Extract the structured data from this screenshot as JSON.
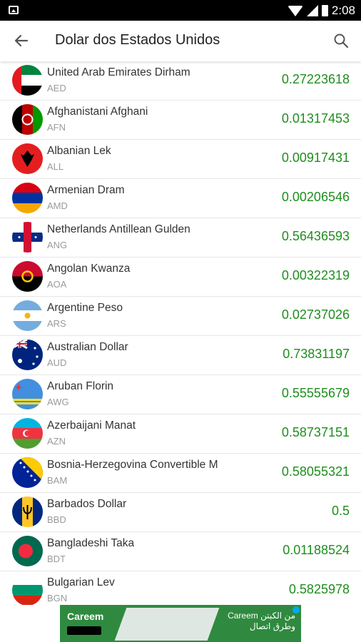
{
  "status": {
    "time": "2:08"
  },
  "appbar": {
    "title": "Dolar dos Estados Unidos"
  },
  "colors": {
    "rate": "#1e8e1e",
    "code": "#9a9a9a",
    "name": "#333333"
  },
  "currencies": [
    {
      "name": "United Arab Emirates Dirham",
      "code": "AED",
      "rate": "0.27223618"
    },
    {
      "name": "Afghanistani Afghani",
      "code": "AFN",
      "rate": "0.01317453"
    },
    {
      "name": "Albanian Lek",
      "code": "ALL",
      "rate": "0.00917431"
    },
    {
      "name": "Armenian Dram",
      "code": "AMD",
      "rate": "0.00206546"
    },
    {
      "name": "Netherlands Antillean Gulden",
      "code": "ANG",
      "rate": "0.56436593"
    },
    {
      "name": "Angolan Kwanza",
      "code": "AOA",
      "rate": "0.00322319"
    },
    {
      "name": "Argentine Peso",
      "code": "ARS",
      "rate": "0.02737026"
    },
    {
      "name": "Australian Dollar",
      "code": "AUD",
      "rate": "0.73831197"
    },
    {
      "name": "Aruban Florin",
      "code": "AWG",
      "rate": "0.55555679"
    },
    {
      "name": "Azerbaijani Manat",
      "code": "AZN",
      "rate": "0.58737151"
    },
    {
      "name": "Bosnia-Herzegovina Convertible M",
      "code": "BAM",
      "rate": "0.58055321"
    },
    {
      "name": "Barbados Dollar",
      "code": "BBD",
      "rate": "0.5"
    },
    {
      "name": "Bangladeshi Taka",
      "code": "BDT",
      "rate": "0.01188524"
    },
    {
      "name": "Bulgarian Lev",
      "code": "BGN",
      "rate": "0.5825978"
    }
  ],
  "ad": {
    "brand": "Careem",
    "text_line1": "Careem من الكبتن",
    "text_line2": "وطرق اتصال"
  }
}
